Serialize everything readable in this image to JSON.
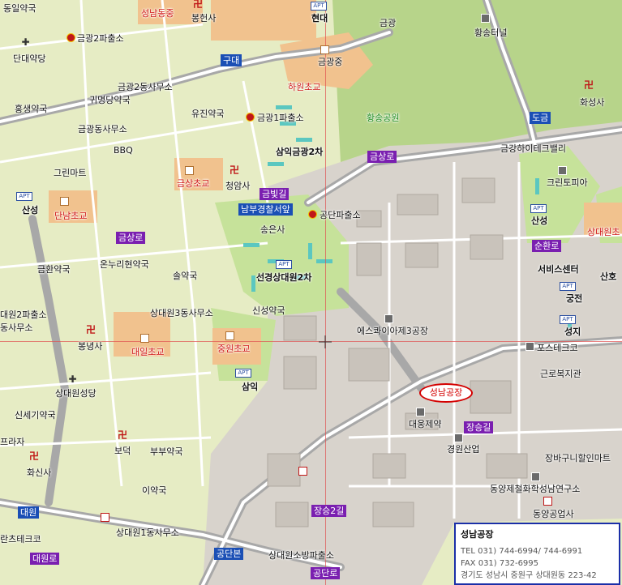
{
  "map": {
    "places": {
      "seongnam_dong": "성남동중",
      "bonghyeonsa": "봉헌사",
      "hyundai": "현대",
      "geumgwang": "금광",
      "hwangsong_tunnel": "황송터널",
      "seongil_pharmacy": "성일약국",
      "gwang2_police": "금광2파출소",
      "danwoldang": "단대약당",
      "gudae": "구대",
      "geumgwang_jung": "금광중",
      "hawon_elem": "하원초교",
      "geumgwang2_office": "금광2동사무소",
      "gwimyeong_pharmacy": "귀명당약국",
      "hwaseongsa": "화성사",
      "hongsaeng_pharmacy": "홍생약국",
      "yujin_pharmacy": "유진약국",
      "geumgwang1_police": "금광1파출소",
      "hwangsong_park": "황송공원",
      "dogeum": "도금",
      "geumgwang_office": "금광동사무소",
      "bbq": "BBQ",
      "samik_gg2": "삼익금광2차",
      "geumgang_heights": "금강하이테크밸리",
      "green_mart": "그린마트",
      "geumsang_ro_top": "금상로",
      "crystal_pia": "크린토피아",
      "geumsang_elem": "금상초교",
      "cheongamsa": "청암사",
      "geumbit_gil": "금빛길",
      "sanseong_left": "산성",
      "dannam_elem": "단남초교",
      "nambu_police": "남부경찰서앞",
      "gongdan_police": "공단파출소",
      "sanseong_right": "산성",
      "sangdaewon_elem": "상대원초",
      "geumsang_ro_left": "금상로",
      "songeunsa": "송은사",
      "sunhwan_ro": "순환로",
      "service_center": "서비스센터",
      "sanho": "산호",
      "geumhwan_pharmacy": "금환약국",
      "onnuri_pharmacy": "온누리현약국",
      "sun_pharmacy": "솔약국",
      "seongyeong": "선경상대원2차",
      "gungjeon": "궁전",
      "daewon2_police": "대원2파출소",
      "sangdaewon3_office": "상대원3동사무소",
      "sinseong_pharmacy": "신성약국",
      "dong_office": "동사무소",
      "seongji": "성지",
      "square3": "에스콰이아제3공장",
      "bongnyeongsa": "봉녕사",
      "daeil_elem": "대일초교",
      "jungwon_elem": "중원초교",
      "poseuteco": "포스테크코",
      "welfare": "근로복지관",
      "samik": "삼익",
      "sangdaewon_seongdang": "상대원성당",
      "seongnam_factory": "성남공장",
      "sinsegi_pharmacy": "신세기약국",
      "daewoong": "대웅제약",
      "jangseung_gil": "장승길",
      "peurasa": "프라자",
      "bodeok": "보덕",
      "bubu_pharmacy": "부부약국",
      "kyungwon": "경원산업",
      "jangbaguni": "장바구니할인마트",
      "hwasinsa": "화신사",
      "iyak": "이약국",
      "dongyang_research": "동양제철화학성남연구소",
      "daewon_tag": "대원",
      "jangseung2_gil": "장승2길",
      "dongyang_industry": "동양공업사",
      "rancheteco": "란츠테크코",
      "sangdaewon1_office": "상대원1동사무소",
      "daewon_ro": "대원로",
      "gongdan_bon": "공단본",
      "fire_station": "상대원소방파출소",
      "gongdan_ro": "공단로",
      "left_top": "동일약국"
    },
    "info": {
      "title": "성남공장",
      "tel": "TEL 031) 744-6994/ 744-6991",
      "fax": "FAX 031) 732-6995",
      "addr": "경기도 성남시 중원구 상대원동 223-42"
    }
  }
}
